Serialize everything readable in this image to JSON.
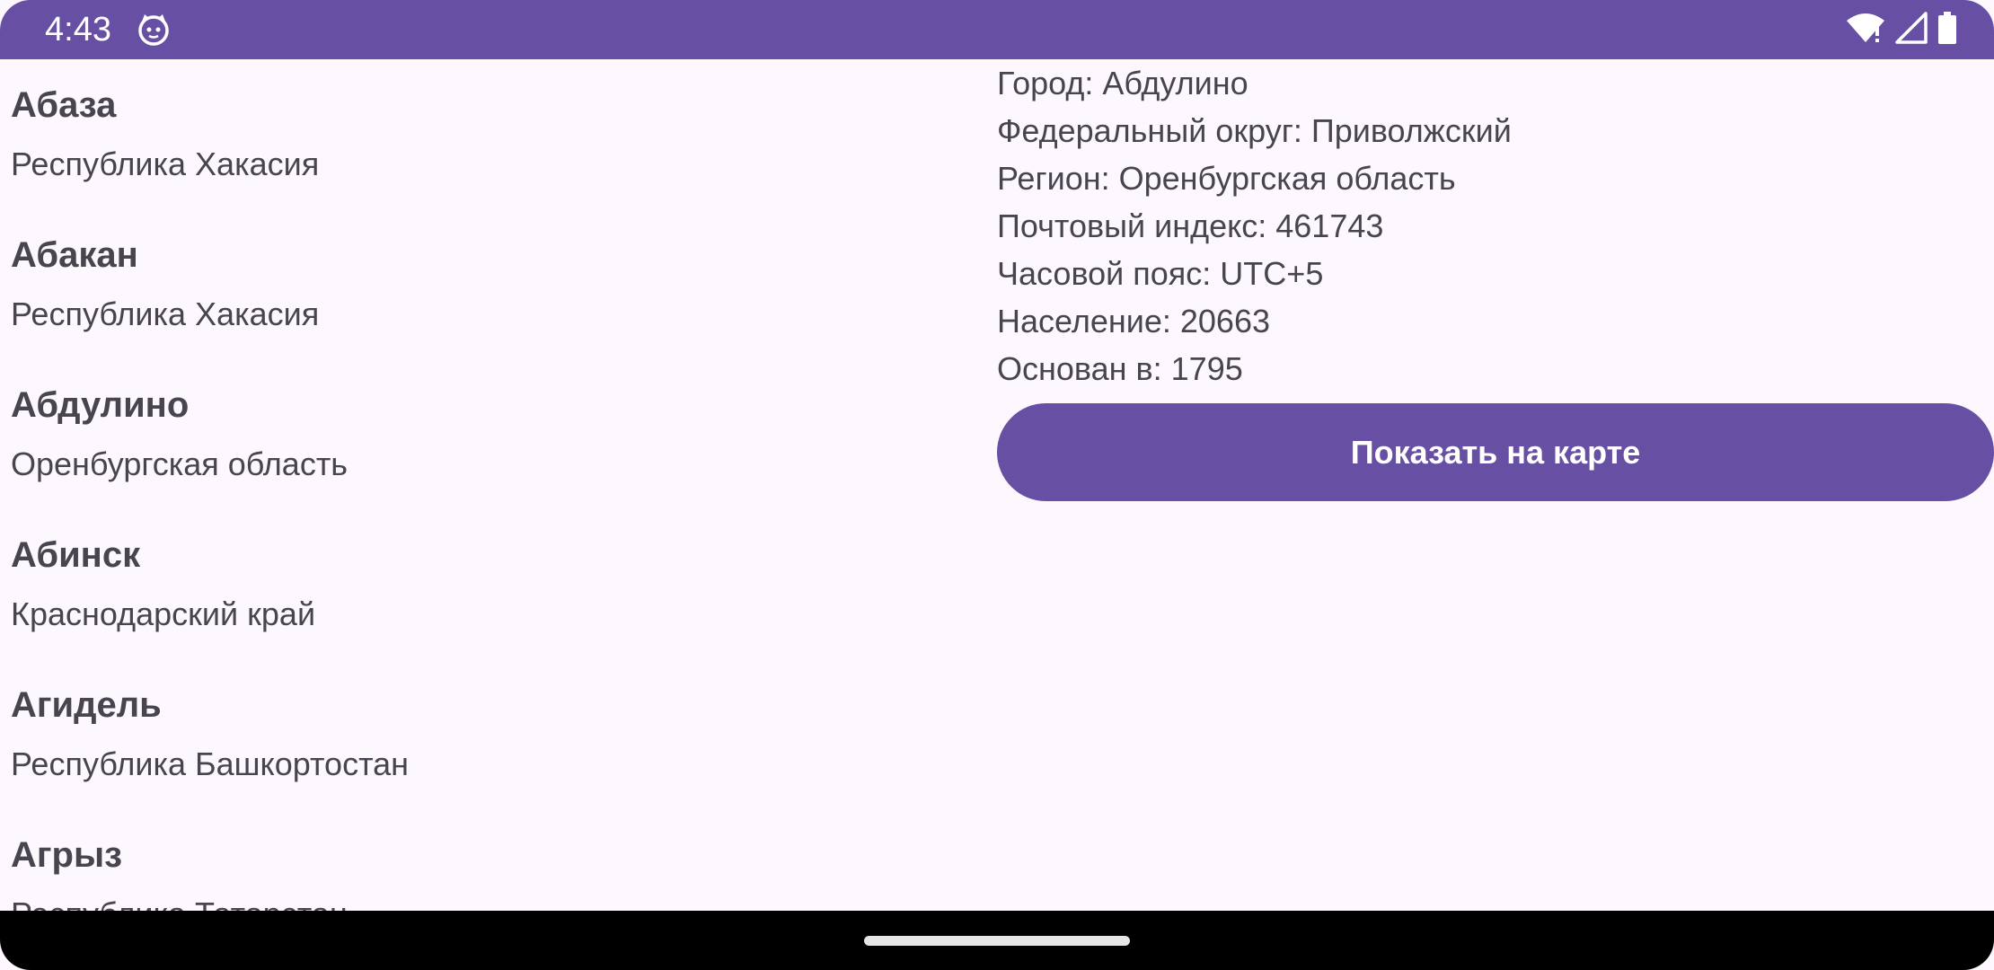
{
  "status_bar": {
    "time": "4:43",
    "icons": [
      "notification-cat-icon",
      "wifi-icon",
      "signal-icon",
      "battery-icon"
    ],
    "color": "#6750A4"
  },
  "city_list": {
    "items": [
      {
        "name": "Абаза",
        "region": "Республика Хакасия"
      },
      {
        "name": "Абакан",
        "region": "Республика Хакасия"
      },
      {
        "name": "Абдулино",
        "region": "Оренбургская область"
      },
      {
        "name": "Абинск",
        "region": "Краснодарский край"
      },
      {
        "name": "Агидель",
        "region": "Республика Башкортостан"
      },
      {
        "name": "Агрыз",
        "region": "Республика Татарстан"
      }
    ]
  },
  "details": {
    "city": "Город: Абдулино",
    "district": "Федеральный округ: Приволжский",
    "region": "Регион: Оренбургская область",
    "postal_code": "Почтовый индекс: 461743",
    "timezone": "Часовой пояс: UTC+5",
    "population": "Население: 20663",
    "founded": "Основан в: 1795",
    "map_button_label": "Показать на карте"
  },
  "colors": {
    "accent": "#6750A4",
    "background": "#FDF7FE",
    "text": "#49454F"
  }
}
